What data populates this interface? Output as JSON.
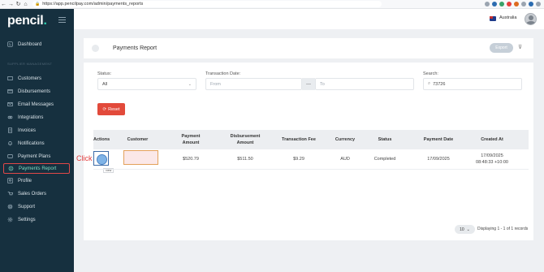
{
  "browser": {
    "url": "https://app.pencilpay.com/admin/payments_reports"
  },
  "sidebar": {
    "logo": "pencil",
    "logo_dot": ".",
    "section_label": "SUPPLIER MANAGEMENT",
    "items": [
      {
        "label": "Dashboard",
        "icon": "dashboard-icon"
      },
      {
        "label": "Customers",
        "icon": "customers-icon"
      },
      {
        "label": "Disbursements",
        "icon": "disbursements-icon"
      },
      {
        "label": "Email Messages",
        "icon": "email-icon"
      },
      {
        "label": "Integrations",
        "icon": "integrations-icon"
      },
      {
        "label": "Invoices",
        "icon": "invoices-icon"
      },
      {
        "label": "Notifications",
        "icon": "notifications-icon"
      },
      {
        "label": "Payment Plans",
        "icon": "payment-plans-icon"
      },
      {
        "label": "Payments Report",
        "icon": "payments-report-icon",
        "active": true
      },
      {
        "label": "Profile",
        "icon": "profile-icon"
      },
      {
        "label": "Sales Orders",
        "icon": "sales-orders-icon"
      },
      {
        "label": "Support",
        "icon": "support-icon"
      },
      {
        "label": "Settings",
        "icon": "settings-icon"
      }
    ]
  },
  "topbar": {
    "country": "Australia"
  },
  "header": {
    "title": "Payments Report",
    "export_label": "Export"
  },
  "filters": {
    "status_label": "Status:",
    "status_value": "All",
    "transaction_date_label": "Transaction Date:",
    "from_placeholder": "From",
    "range_separator": "—",
    "to_placeholder": "To",
    "search_label": "Search:",
    "search_value": "73726",
    "reset_label": "Reset"
  },
  "table": {
    "columns": [
      "Actions",
      "Customer",
      "Payment Amount",
      "Disbursement Amount",
      "Transaction Fee",
      "Currency",
      "Status",
      "Payment Date",
      "Created At"
    ],
    "rows": [
      {
        "customer": "",
        "payment_amount": "$520.79",
        "disbursement_amount": "$511.50",
        "transaction_fee": "$9.29",
        "currency": "AUD",
        "status": "Completed",
        "payment_date": "17/09/2025",
        "created_at_date": "17/09/2025",
        "created_at_time": "08:48:33 +10:00"
      }
    ],
    "view_tooltip": "View",
    "click_annotation": "Click"
  },
  "pagination": {
    "per_page": "10",
    "info": "Displaying 1 - 1 of 1 records"
  },
  "colors": {
    "sidebar_bg": "#16303f",
    "accent_teal": "#2fd0b0",
    "reset_red": "#e24a3b",
    "highlight_red": "#e23a3a"
  }
}
